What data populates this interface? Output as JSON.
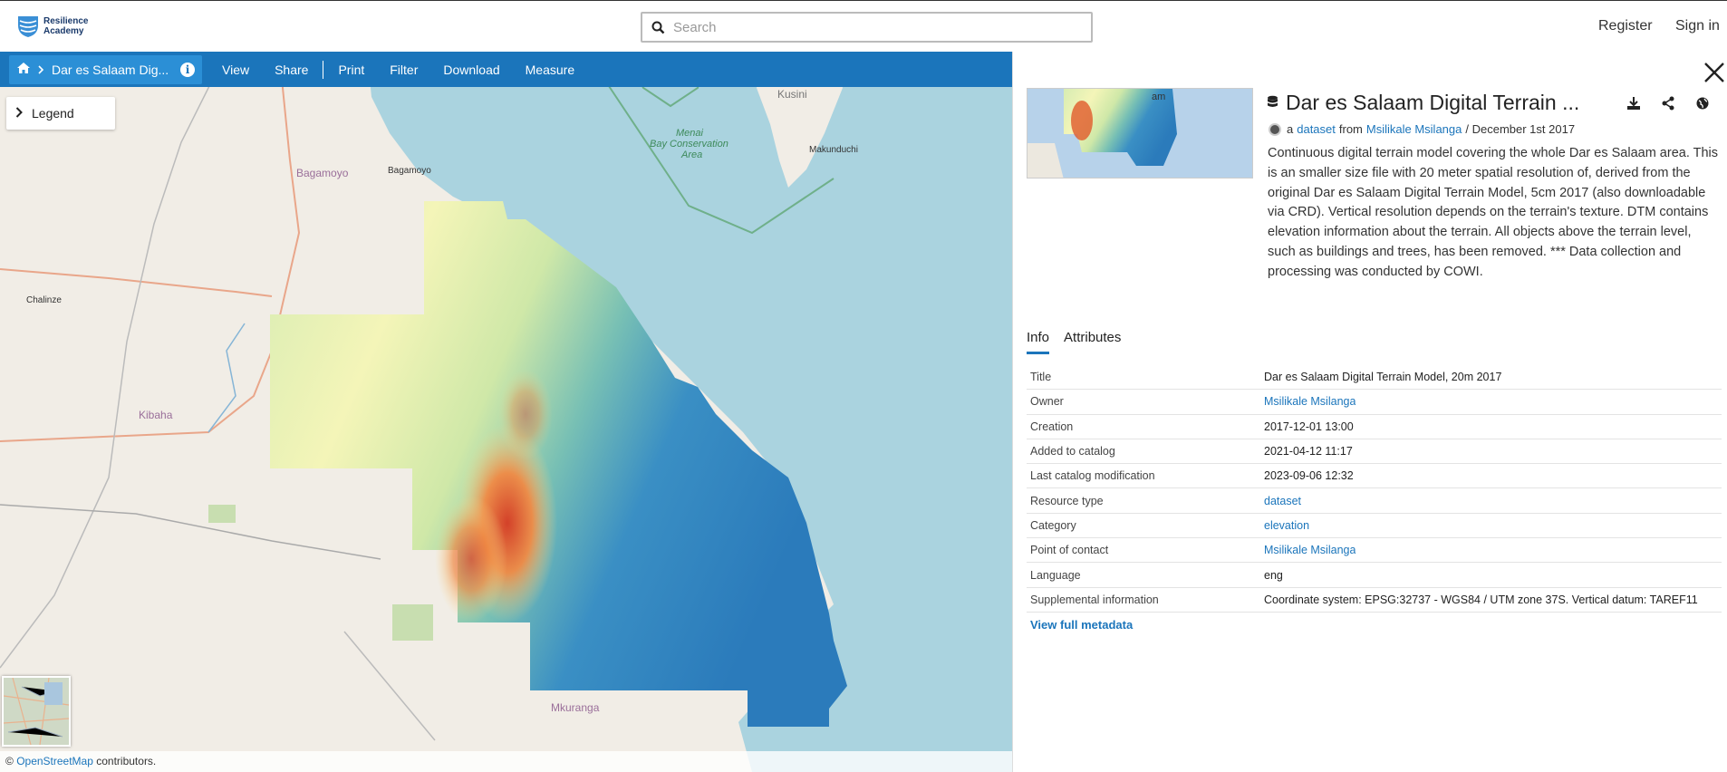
{
  "brand": {
    "name_line1": "Resilience",
    "name_line2": "Academy",
    "color": "#1a3a6b"
  },
  "search": {
    "placeholder": "Search"
  },
  "auth": {
    "register": "Register",
    "sign_in": "Sign in"
  },
  "toolbar": {
    "breadcrumb_title": "Dar es Salaam Dig...",
    "items": [
      "View",
      "Share",
      "Print",
      "Filter",
      "Download",
      "Measure"
    ],
    "accent": "#1b75bb"
  },
  "map": {
    "legend_label": "Legend",
    "labels": {
      "bagamoyo_district": "Bagamoyo",
      "bagamoyo_town": "Bagamoyo",
      "chalinze": "Chalinze",
      "kibaha": "Kibaha",
      "kusini": "Kusini",
      "makunduchi": "Makunduchi",
      "menai1": "Menai",
      "menai2": "Bay Conservation",
      "menai3": "Area",
      "mkuranga": "Mkuranga",
      "am": "am"
    },
    "attribution_prefix": "© ",
    "attribution_link": "OpenStreetMap",
    "attribution_suffix": " contributors."
  },
  "resource": {
    "title": "Dar es Salaam Digital Terrain ...",
    "byline_prefix": "a",
    "type_link": "dataset",
    "from_text": "from",
    "owner_link": "Msilikale Msilanga",
    "date": "/ December 1st 2017",
    "description": "Continuous digital terrain model covering the whole Dar es Salaam area. This is an smaller size file with 20 meter spatial resolution of, derived from the original Dar es Salaam Digital Terrain Model, 5cm 2017 (also downloadable via CRD). Vertical resolution depends on the terrain's texture. DTM contains elevation information about the terrain. All objects above the terrain level, such as buildings and trees, has been removed. *** Data collection and processing was conducted by COWI."
  },
  "tabs": [
    {
      "label": "Info"
    },
    {
      "label": "Attributes"
    }
  ],
  "info": [
    {
      "key": "Title",
      "value": "Dar es Salaam Digital Terrain Model, 20m 2017",
      "link": false
    },
    {
      "key": "Owner",
      "value": "Msilikale Msilanga",
      "link": true
    },
    {
      "key": "Creation",
      "value": "2017-12-01 13:00",
      "link": false
    },
    {
      "key": "Added to catalog",
      "value": "2021-04-12 11:17",
      "link": false
    },
    {
      "key": "Last catalog modification",
      "value": "2023-09-06 12:32",
      "link": false
    },
    {
      "key": "Resource type",
      "value": "dataset",
      "link": true
    },
    {
      "key": "Category",
      "value": "elevation",
      "link": true
    },
    {
      "key": "Point of contact",
      "value": "Msilikale Msilanga",
      "link": true
    },
    {
      "key": "Language",
      "value": "eng",
      "link": false
    },
    {
      "key": "Supplemental information",
      "value": "Coordinate system: EPSG:32737 - WGS84 / UTM zone 37S. Vertical datum: TAREF11",
      "link": false
    }
  ],
  "view_full_metadata": "View full metadata"
}
